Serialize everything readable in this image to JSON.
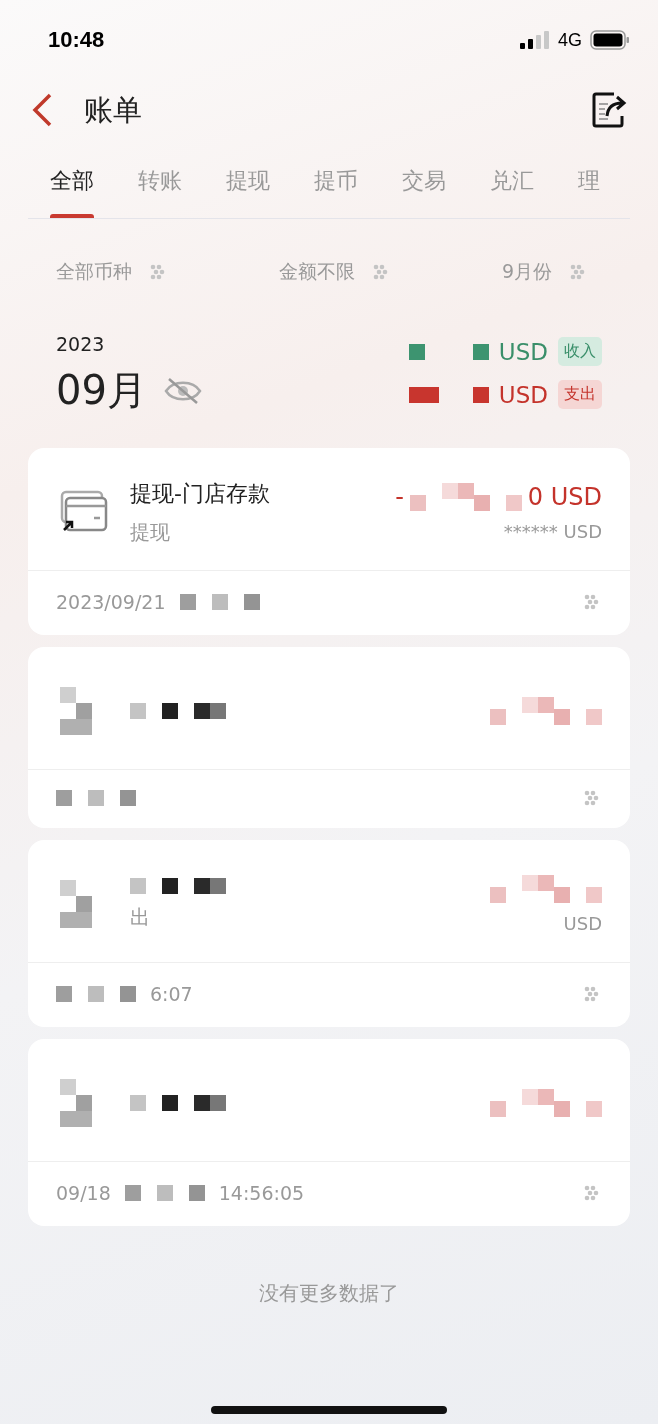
{
  "status_bar": {
    "time": "10:48",
    "network": "4G"
  },
  "header": {
    "title": "账单"
  },
  "tabs": [
    {
      "label": "全部",
      "selected": true
    },
    {
      "label": "转账",
      "selected": false
    },
    {
      "label": "提现",
      "selected": false
    },
    {
      "label": "提币",
      "selected": false
    },
    {
      "label": "交易",
      "selected": false
    },
    {
      "label": "兑汇",
      "selected": false
    },
    {
      "label": "理",
      "selected": false
    }
  ],
  "filters": [
    {
      "label": "全部币种"
    },
    {
      "label": "金额不限"
    },
    {
      "label": "9月份"
    }
  ],
  "summary": {
    "year": "2023",
    "month": "09月",
    "totals": [
      {
        "kind": "income",
        "amount": "USD",
        "tag": "收入"
      },
      {
        "kind": "expense",
        "amount": "USD",
        "tag": "支出"
      }
    ]
  },
  "bills": [
    {
      "kind": "withdraw",
      "title": "提现-门店存款",
      "subtitle": "提现",
      "sign": "-",
      "amount": "0 USD",
      "expense": true,
      "balance": "****** USD",
      "date": "2023/09/21"
    },
    {
      "kind": "hidden"
    },
    {
      "kind": "hidden",
      "subtitle": "出",
      "balance": "USD",
      "time": "6:07"
    },
    {
      "kind": "hidden-card",
      "date": "09/18",
      "time": "14:56:05"
    }
  ],
  "footer": "没有更多数据了"
}
